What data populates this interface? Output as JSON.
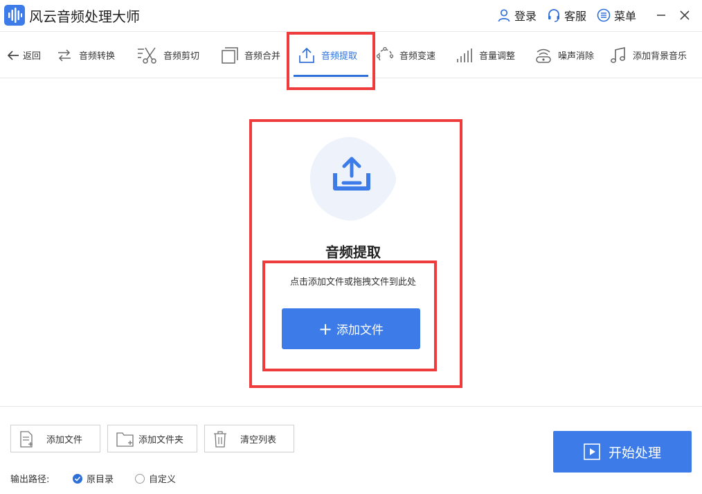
{
  "app": {
    "title": "风云音频处理大师"
  },
  "titlebar": {
    "login": "登录",
    "service": "客服",
    "menu": "菜单"
  },
  "toolbar": {
    "back": "返回",
    "items": [
      {
        "label": "音频转换",
        "icon": "convert-icon"
      },
      {
        "label": "音频剪切",
        "icon": "cut-icon"
      },
      {
        "label": "音频合并",
        "icon": "merge-icon"
      },
      {
        "label": "音频提取",
        "icon": "extract-icon",
        "active": true
      },
      {
        "label": "音频变速",
        "icon": "speed-icon"
      },
      {
        "label": "音量调整",
        "icon": "volume-icon"
      },
      {
        "label": "噪声消除",
        "icon": "noise-icon"
      },
      {
        "label": "添加背景音乐",
        "icon": "music-note-icon"
      }
    ]
  },
  "dropzone": {
    "title": "音频提取",
    "hint": "点击添加文件或拖拽文件到此处",
    "add_button": "添加文件",
    "plus": "+"
  },
  "bottom": {
    "add_file": "添加文件",
    "add_folder": "添加文件夹",
    "clear_list": "清空列表",
    "output_label": "输出路径:",
    "output_options": [
      {
        "label": "原目录",
        "selected": true
      },
      {
        "label": "自定义",
        "selected": false
      }
    ],
    "start": "开始处理"
  },
  "colors": {
    "accent": "#3d7ce8",
    "annotation_red": "#ee3b3b"
  }
}
